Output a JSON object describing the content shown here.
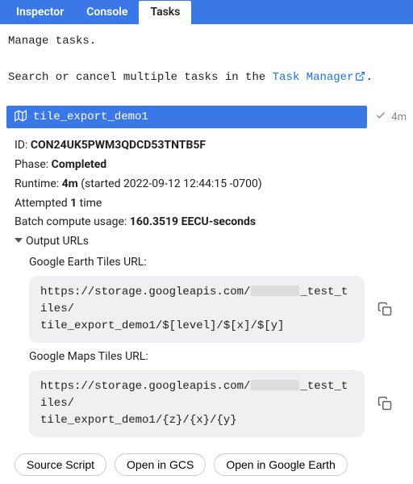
{
  "tabs": {
    "inspector": "Inspector",
    "console": "Console",
    "tasks": "Tasks"
  },
  "intro": {
    "line1": "Manage tasks.",
    "line2a": "Search or cancel multiple tasks in the ",
    "link": "Task Manager",
    "line2b": "."
  },
  "task": {
    "title": "tile_export_demo1",
    "meta_time": "4m",
    "id_label": "ID: ",
    "id_value": "CON24UK5PWM3QDCD53TNTB5F",
    "phase_label": "Phase: ",
    "phase_value": "Completed",
    "runtime_label": "Runtime: ",
    "runtime_value": "4m",
    "runtime_paren": " (started 2022-09-12 12:44:15 -0700)",
    "attempted_a": "Attempted ",
    "attempted_n": "1",
    "attempted_b": " time",
    "batch_label": "Batch compute usage: ",
    "batch_value": "160.3519 EECU-seconds",
    "output_urls_label": "Output URLs"
  },
  "urls": {
    "ge_label": "Google Earth Tiles URL:",
    "ge_a": "https://storage.googleapis.com/",
    "ge_b": "_test_tiles/",
    "ge_c": "tile_export_demo1/$[level]/$[x]/$[y]",
    "gm_label": "Google Maps Tiles URL:",
    "gm_a": "https://storage.googleapis.com/",
    "gm_b": "_test_tiles/",
    "gm_c": "tile_export_demo1/{z}/{x}/{y}"
  },
  "buttons": {
    "source": "Source Script",
    "gcs": "Open in GCS",
    "earth": "Open in Google Earth"
  }
}
